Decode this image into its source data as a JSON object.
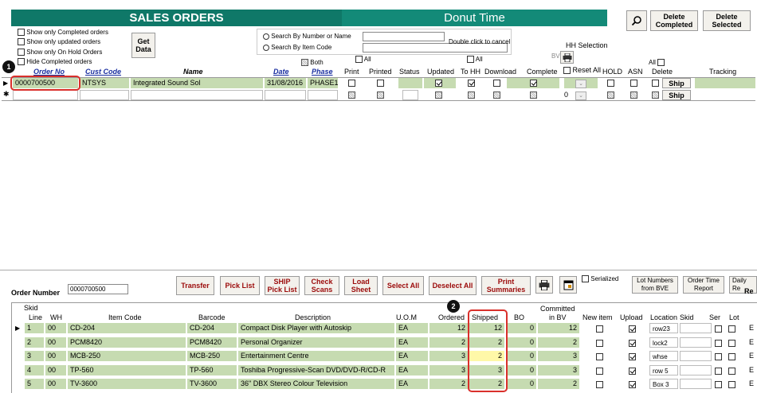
{
  "header": {
    "title": "SALES ORDERS",
    "company": "Donut Time"
  },
  "top_buttons": {
    "search_label": "",
    "delete_completed": "Delete\nCompleted",
    "delete_selected": "Delete\nSelected"
  },
  "filters": {
    "show_completed": "Show only Completed orders",
    "show_updated": "Show only updated orders",
    "show_on_hold": "Show only On Hold Orders",
    "hide_completed": "Hide Completed orders",
    "get_data": "Get\nData"
  },
  "search": {
    "by_number": "Search By Number or Name",
    "by_item": "Search By Item Code",
    "hint": "Double click to cancel"
  },
  "hh_selection": "HH Selection",
  "bv_label": "BV",
  "both_label": "Both",
  "all_label": "All",
  "grid_headers": {
    "order_no": "Order No",
    "cust_code": "Cust Code",
    "name": "Name",
    "date": "Date",
    "phase": "Phase",
    "print": "Print",
    "printed": "Printed",
    "status": "Status",
    "updated": "Updated",
    "to_hh": "To HH",
    "download": "Download",
    "complete": "Complete",
    "reset_all": "Reset All",
    "hold": "HOLD",
    "asn": "ASN",
    "delete": "Delete",
    "tracking": "Tracking"
  },
  "order_row": {
    "order_no": "0000700500",
    "cust_code": "NTSYS",
    "name": "Integrated Sound Sol",
    "date": "31/08/2016",
    "phase": "PHASE1",
    "ship": "Ship"
  },
  "new_row": {
    "zero": "0",
    "ship": "Ship"
  },
  "markers": {
    "m1": "1",
    "m2": "2"
  },
  "bottom": {
    "order_number_label": "Order Number",
    "order_number_value": "0000700500",
    "buttons": [
      "Transfer",
      "Pick List",
      "SHIP\nPick List",
      "Check\nScans",
      "Load\nSheet",
      "Select All",
      "Deselect All",
      "Print\nSummaries"
    ],
    "serialized": "Serialized",
    "lot_numbers": "Lot Numbers\nfrom BVE",
    "order_time_report": "Order Time\nReport",
    "daily_re": "Daily Re",
    "re": "Re"
  },
  "lines_headers": {
    "skid": "Skid",
    "line": "Line",
    "wh": "WH",
    "item_code": "Item Code",
    "barcode": "Barcode",
    "description": "Description",
    "uom": "U.O.M",
    "ordered": "Ordered",
    "shipped": "Shipped",
    "bo": "BO",
    "committed": "Committed\nin BV",
    "new_item": "New item",
    "upload": "Upload",
    "location": "Location",
    "skid2": "Skid",
    "ser": "Ser",
    "lot": "Lot"
  },
  "lines": [
    {
      "line": "1",
      "wh": "00",
      "item": "CD-204",
      "barcode": "CD-204",
      "desc": "Compact Disk Player with Autoskip",
      "uom": "EA",
      "ordered": "12",
      "shipped": "12",
      "bo": "0",
      "committed": "12",
      "location": "row23",
      "e": "E"
    },
    {
      "line": "2",
      "wh": "00",
      "item": "PCM8420",
      "barcode": "PCM8420",
      "desc": "Personal Organizer",
      "uom": "EA",
      "ordered": "2",
      "shipped": "2",
      "bo": "0",
      "committed": "2",
      "location": "lock2",
      "e": "E"
    },
    {
      "line": "3",
      "wh": "00",
      "item": "MCB-250",
      "barcode": "MCB-250",
      "desc": "Entertainment Centre",
      "uom": "EA",
      "ordered": "3",
      "shipped": "2",
      "bo": "0",
      "committed": "3",
      "location": "whse",
      "e": "E"
    },
    {
      "line": "4",
      "wh": "00",
      "item": "TP-560",
      "barcode": "TP-560",
      "desc": "Toshiba Progressive-Scan DVD/DVD-R/CD-R",
      "uom": "EA",
      "ordered": "3",
      "shipped": "3",
      "bo": "0",
      "committed": "3",
      "location": "row 5",
      "e": "E"
    },
    {
      "line": "5",
      "wh": "00",
      "item": "TV-3600",
      "barcode": "TV-3600",
      "desc": "36\" DBX Stereo Colour Television",
      "uom": "EA",
      "ordered": "2",
      "shipped": "2",
      "bo": "0",
      "committed": "2",
      "location": "Box 3",
      "e": "E"
    }
  ]
}
